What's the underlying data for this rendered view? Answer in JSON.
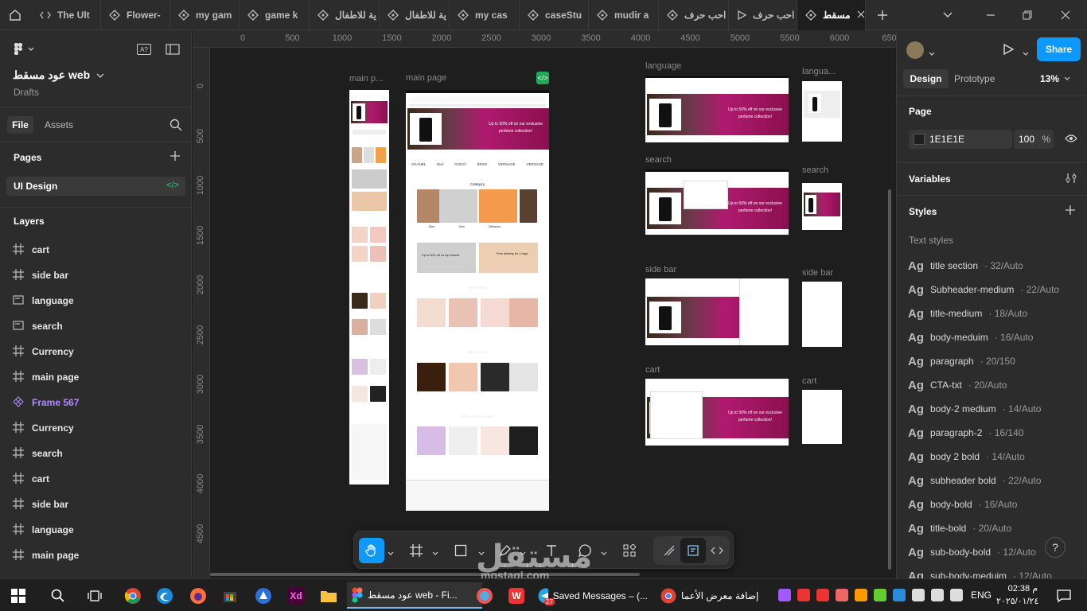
{
  "tabs": [
    "The Ult",
    "Flower-",
    "my gam",
    "game k",
    "ية للاطفال",
    "ية للاطفال",
    "my cas",
    "caseStu",
    "mudir a",
    "احب حرف",
    "احب حرف",
    "مسقط"
  ],
  "file": {
    "name": "عود مسقط web",
    "location": "Drafts"
  },
  "nav": {
    "file": "File",
    "assets": "Assets"
  },
  "pages_header": "Pages",
  "current_page": "UI Design",
  "layers_header": "Layers",
  "layers": [
    {
      "name": "cart",
      "icon": "frame-icon"
    },
    {
      "name": "side bar",
      "icon": "frame-icon"
    },
    {
      "name": "language",
      "icon": "section-icon"
    },
    {
      "name": "search",
      "icon": "section-icon"
    },
    {
      "name": "Currency",
      "icon": "frame-icon"
    },
    {
      "name": "main page",
      "icon": "frame-icon"
    },
    {
      "name": "Frame 567",
      "icon": "component-icon"
    },
    {
      "name": "Currency",
      "icon": "frame-icon"
    },
    {
      "name": "search",
      "icon": "frame-icon"
    },
    {
      "name": "cart",
      "icon": "frame-icon"
    },
    {
      "name": "side bar",
      "icon": "frame-icon"
    },
    {
      "name": "language",
      "icon": "frame-icon"
    },
    {
      "name": "main page",
      "icon": "frame-icon"
    }
  ],
  "ruler_h": [
    "0",
    "500",
    "1000",
    "1500",
    "2000",
    "2500",
    "3000",
    "3500",
    "4000",
    "4500",
    "5000",
    "5500",
    "6000",
    "650"
  ],
  "ruler_v": [
    "0",
    "500",
    "1000",
    "1500",
    "2000",
    "2500",
    "3000",
    "3500",
    "4000",
    "4500"
  ],
  "frames": {
    "main_p": "main p...",
    "main_page": "main page",
    "language": "language",
    "language_small": "langua...",
    "search": "search",
    "search_small": "search",
    "side_bar": "side bar",
    "side_bar_small": "side bar",
    "cart": "cart",
    "cart_small": "cart"
  },
  "mockup": {
    "promo": "Up to 50% off on our exclusive perfume collection!",
    "brands": [
      "CHANEL",
      "Dior",
      "GUCCI",
      "BOSS",
      "VERSACE",
      "VERSACE"
    ],
    "category": "Category",
    "categories": [
      "Men",
      "Men",
      "Diffusers",
      ""
    ],
    "offer1": "Up to 50% off on top brands",
    "offer2": "Free delivery for 2 days",
    "best_seller": "Best Seller",
    "new_arrival": "New Arrival",
    "offers_discounts": "Offers and Discounts"
  },
  "right": {
    "share": "Share",
    "tab_design": "Design",
    "tab_prototype": "Prototype",
    "zoom": "13%",
    "page_label": "Page",
    "page_color": "1E1E1E",
    "page_opacity": "100",
    "percent": "%",
    "variables": "Variables",
    "styles": "Styles",
    "text_styles": "Text styles",
    "ag": "Ag",
    "text_style_list": [
      {
        "name": "title section",
        "meta": "32/Auto"
      },
      {
        "name": "Subheader-medium",
        "meta": "22/Auto"
      },
      {
        "name": "title-medium",
        "meta": "18/Auto"
      },
      {
        "name": "body-meduim",
        "meta": "16/Auto"
      },
      {
        "name": "paragraph",
        "meta": "20/150"
      },
      {
        "name": "CTA-txt",
        "meta": "20/Auto"
      },
      {
        "name": "body-2 medium",
        "meta": "14/Auto"
      },
      {
        "name": "paragraph-2",
        "meta": "16/140"
      },
      {
        "name": "body 2 bold",
        "meta": "14/Auto"
      },
      {
        "name": "subheader bold",
        "meta": "22/Auto"
      },
      {
        "name": "body-bold",
        "meta": "16/Auto"
      },
      {
        "name": "title-bold",
        "meta": "20/Auto"
      },
      {
        "name": "sub-body-bold",
        "meta": "12/Auto"
      },
      {
        "name": "sub-body-meduim",
        "meta": "12/Auto"
      }
    ]
  },
  "taskbar": {
    "figma_title": "عود مسقط web - Fi...",
    "telegram_title": "Saved Messages – (...",
    "chrome_title": "إضافة معرض الأعما",
    "telegram_badge": "27",
    "lang": "ENG",
    "time": "02:38 م",
    "date": "٢٠٢٥/٠١/٢٤"
  },
  "watermark": {
    "arabic": "مستقل",
    "latin": "mostaql.com"
  },
  "colors": {
    "accent": "#0d99ff",
    "panel": "#2c2c2c",
    "canvas": "#1e1e1e",
    "magenta": "#b01a6e",
    "purple": "#b18cff"
  }
}
